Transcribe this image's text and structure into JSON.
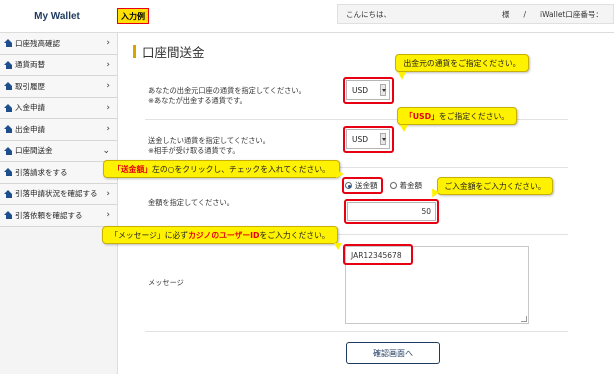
{
  "header": {
    "logo": "My Wallet",
    "example_tag": "入力例",
    "greeting": "こんにちは、",
    "sama": "様",
    "sep": "/",
    "account": "iWallet口座番号："
  },
  "sidebar": {
    "items": [
      {
        "label": "口座残高確認"
      },
      {
        "label": "通貨両替"
      },
      {
        "label": "取引履歴"
      },
      {
        "label": "入金申請"
      },
      {
        "label": "出金申請"
      },
      {
        "label": "口座間送金"
      },
      {
        "label": "引落請求をする"
      },
      {
        "label": "引落申請状況を確認する"
      },
      {
        "label": "引落依頼を確認する"
      }
    ]
  },
  "main": {
    "title": "口座間送金",
    "source_currency_label_1": "あなたの出金元口座の通貨を指定してください。",
    "source_currency_label_2": "※あなたが出金する通貨です。",
    "source_currency_value": "USD",
    "send_currency_label_1": "送金したい通貨を指定してください。",
    "send_currency_label_2": "※相手が受け取る通貨です。",
    "send_currency_value": "USD",
    "radio_send": "送金額",
    "radio_receive": "着金額",
    "amount_label": "金額を指定してください。",
    "amount_value": "50",
    "message_label": "メッセージ",
    "message_value": "JAR12345678",
    "confirm_button": "確認画面へ"
  },
  "callouts": {
    "c1": "出金元の通貨をご指定ください。",
    "c2_red": "「USD」",
    "c2_rest": "をご指定ください。",
    "c3_red": "「送金額」",
    "c3_rest": "左の○をクリックし、チェックを入れてください。",
    "c4": "ご入金額をご入力ください。",
    "c5_pre": "「メッセージ」に必ず",
    "c5_red": "カジノのユーザーID",
    "c5_post": "をご入力ください。"
  },
  "colors": {
    "callout_yellow": "#fff200",
    "highlight_red": "#e60012",
    "nav_blue": "#1f4e8c",
    "title_bar": "#d9a400"
  }
}
